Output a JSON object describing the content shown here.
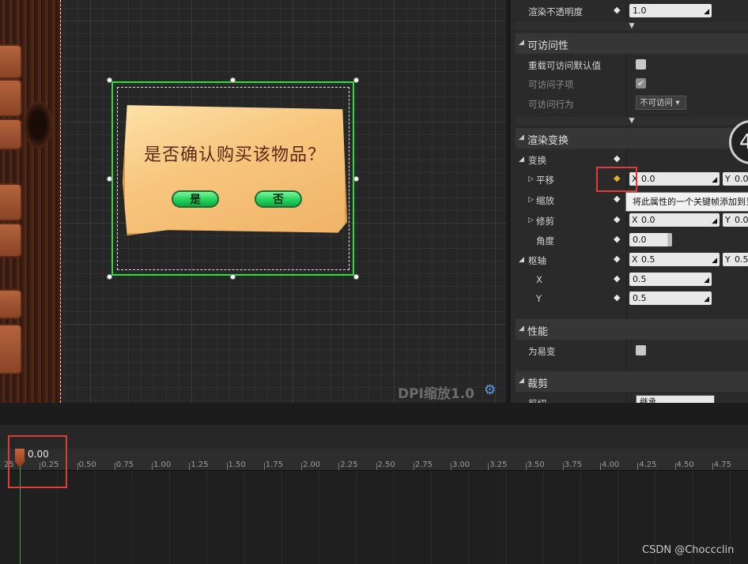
{
  "canvas": {
    "dialog_text": "是否确认购买该物品？",
    "yes_label": "是",
    "no_label": "否",
    "dpi_label": "DPI缩放1.0",
    "gear_icon": "gear-icon"
  },
  "details": {
    "render_opacity": {
      "label": "渲染不透明度",
      "value": "1.0"
    },
    "accessibility": {
      "title": "可访问性",
      "override_label": "重载可访问默认值",
      "children_label": "可访问子项",
      "behavior_label": "可访问行为",
      "behavior_value": "不可访问"
    },
    "render_transform": {
      "title": "渲染变换",
      "transform_label": "变换",
      "translation_label": "平移",
      "translation_x": "0.0",
      "translation_y": "0.0",
      "scale_label": "缩放",
      "shear_label": "修剪",
      "shear_x": "0.0",
      "shear_y": "0.0",
      "angle_label": "角度",
      "angle_value": "0.0",
      "pivot_label": "枢轴",
      "pivot_x": "0.5",
      "pivot_y": "0.5",
      "x_label": "X",
      "y_label": "Y",
      "x_value": "0.5",
      "y_value": "0.5"
    },
    "tooltip": "将此属性的一个关键帧添加到当",
    "performance": {
      "title": "性能",
      "volatile_label": "为易变"
    },
    "clipping": {
      "title": "裁剪",
      "clip_label": "剪切",
      "clip_value": "继承"
    },
    "axis_x": "X",
    "axis_y": "Y",
    "badge": "4"
  },
  "timeline": {
    "current_time": "0.00",
    "ticks": [
      "25",
      "0.25",
      "0.50",
      "0.75",
      "1.00",
      "1.25",
      "1.50",
      "1.75",
      "2.00",
      "2.25",
      "2.50",
      "2.75",
      "3.00",
      "3.25",
      "3.50",
      "3.75",
      "4.00",
      "4.25",
      "4.50",
      "4.75"
    ]
  },
  "watermark": "CSDN @Choccclin"
}
